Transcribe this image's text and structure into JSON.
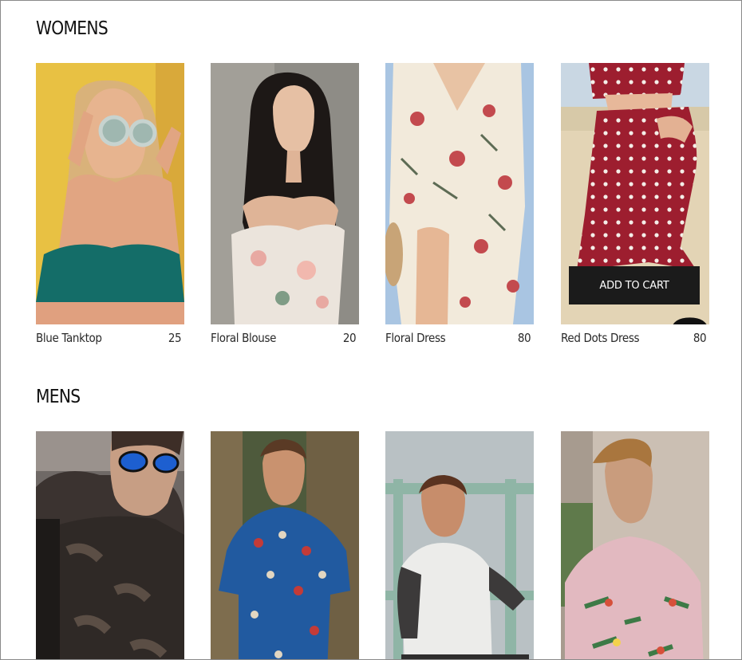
{
  "sections": [
    {
      "title": "WOMENS",
      "products": [
        {
          "name": "Blue Tanktop",
          "price": "25"
        },
        {
          "name": "Floral Blouse",
          "price": "20"
        },
        {
          "name": "Floral Dress",
          "price": "80"
        },
        {
          "name": "Red Dots Dress",
          "price": "80"
        }
      ]
    },
    {
      "title": "MENS",
      "products": [
        {
          "image": "man in camo vest and blue sunglasses"
        },
        {
          "image": "man in blue floral shirt"
        },
        {
          "image": "man in raglan tee on railing"
        },
        {
          "image": "man in pink floral shirt"
        }
      ]
    }
  ],
  "hover_card": {
    "button_label": "ADD TO CART",
    "cursor": "hand-pointer-icon"
  },
  "colors": {
    "button_bg": "#1b1b1b",
    "button_text": "#ffffff",
    "title_text": "#111111"
  }
}
